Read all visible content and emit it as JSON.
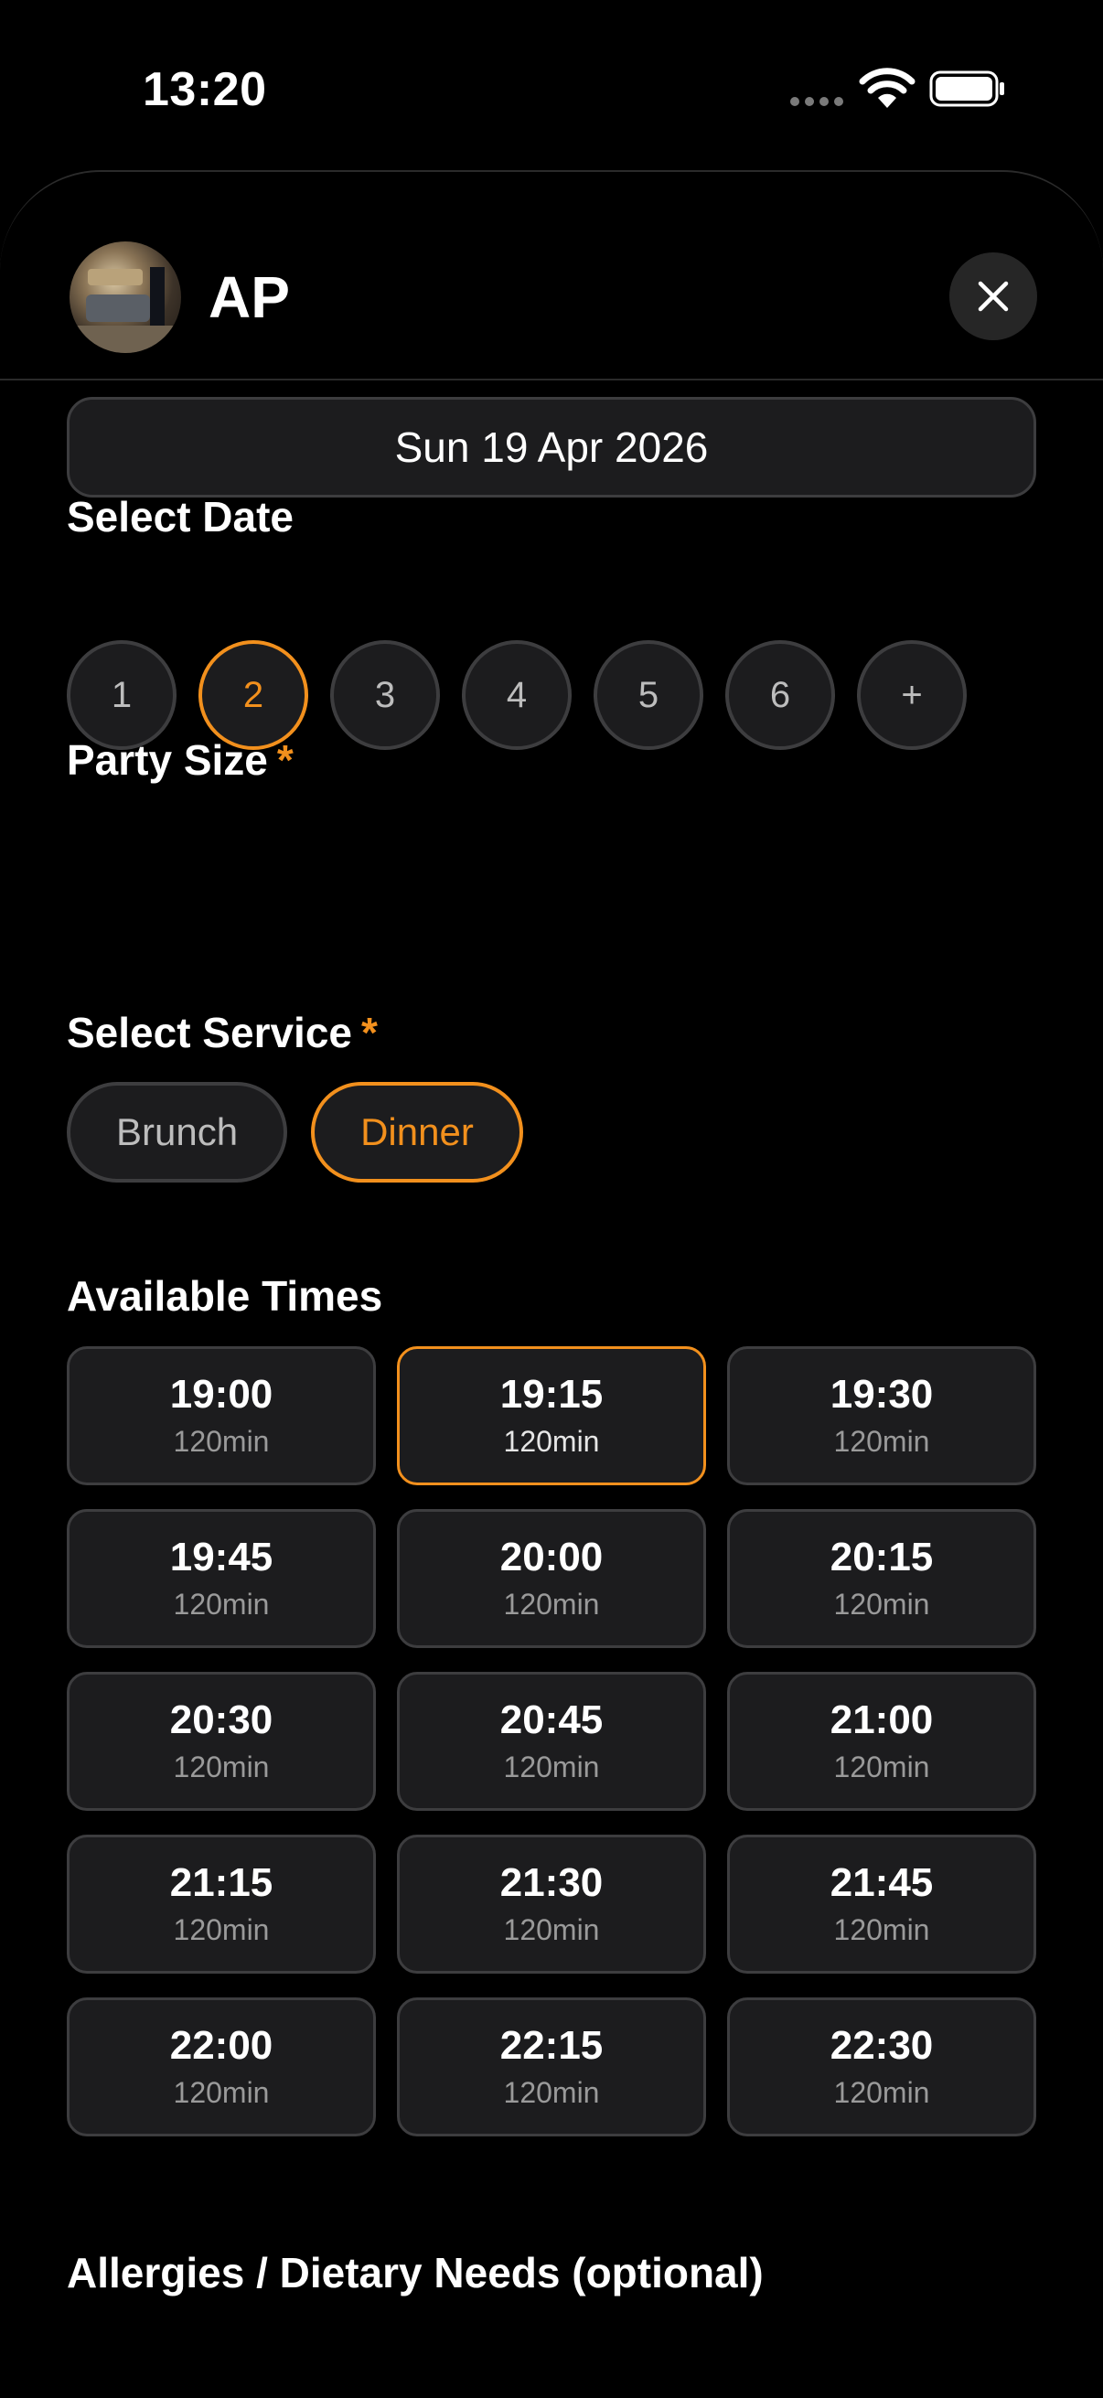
{
  "status_bar": {
    "time": "13:20"
  },
  "header": {
    "venue_name": "AP",
    "close_icon": "close-icon"
  },
  "date": {
    "label": "Select Date",
    "value": "Sun 19 Apr 2026"
  },
  "party_size": {
    "label": "Party Size",
    "required_marker": "*",
    "options": [
      "1",
      "2",
      "3",
      "4",
      "5",
      "6",
      "+"
    ],
    "selected": "2"
  },
  "service": {
    "label": "Select Service",
    "required_marker": "*",
    "options": [
      "Brunch",
      "Dinner"
    ],
    "selected": "Dinner"
  },
  "times": {
    "label": "Available Times",
    "slots": [
      {
        "time": "19:00",
        "duration": "120min"
      },
      {
        "time": "19:15",
        "duration": "120min",
        "selected": true
      },
      {
        "time": "19:30",
        "duration": "120min"
      },
      {
        "time": "19:45",
        "duration": "120min"
      },
      {
        "time": "20:00",
        "duration": "120min"
      },
      {
        "time": "20:15",
        "duration": "120min"
      },
      {
        "time": "20:30",
        "duration": "120min"
      },
      {
        "time": "20:45",
        "duration": "120min"
      },
      {
        "time": "21:00",
        "duration": "120min"
      },
      {
        "time": "21:15",
        "duration": "120min"
      },
      {
        "time": "21:30",
        "duration": "120min"
      },
      {
        "time": "21:45",
        "duration": "120min"
      },
      {
        "time": "22:00",
        "duration": "120min"
      },
      {
        "time": "22:15",
        "duration": "120min"
      },
      {
        "time": "22:30",
        "duration": "120min"
      }
    ]
  },
  "allergies": {
    "label": "Allergies / Dietary Needs (optional)"
  },
  "colors": {
    "accent": "#f2901d",
    "surface": "#1c1c1e",
    "border": "#3d3d3f",
    "background": "#000000"
  }
}
